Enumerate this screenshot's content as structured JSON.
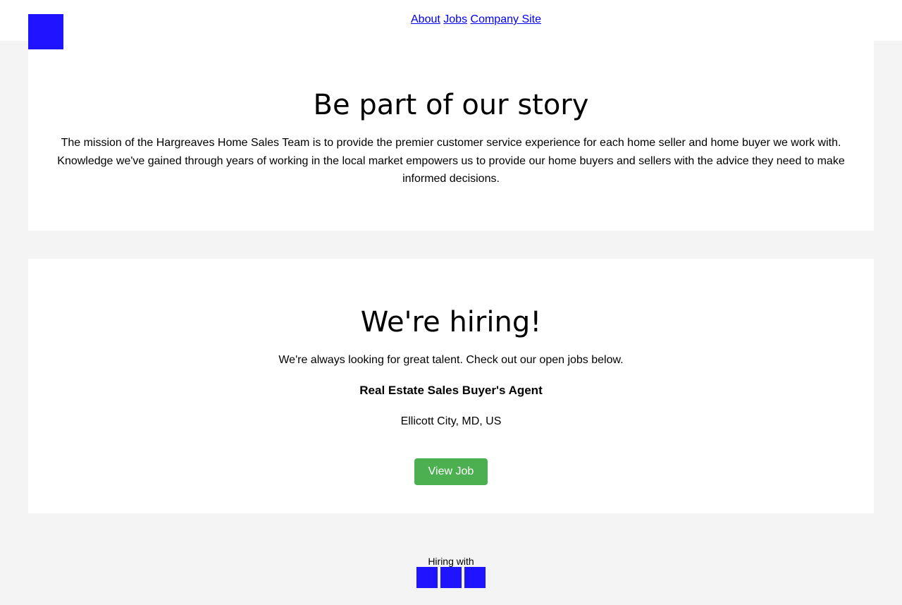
{
  "header": {
    "logo_icon": "company-logo",
    "nav": [
      {
        "label": "About"
      },
      {
        "label": "Jobs"
      },
      {
        "label": "Company Site"
      }
    ]
  },
  "story": {
    "title": "Be part of our story",
    "text": "The mission of the Hargreaves Home Sales Team is to provide the premier customer service experience for each home seller and home buyer we work with. Knowledge we've gained through years of working in the local market empowers us to provide our home buyers and sellers with the advice they need to make informed decisions."
  },
  "hiring": {
    "title": "We're hiring!",
    "tagline": "We're always looking for great talent. Check out our open jobs below.",
    "job": {
      "title": "Real Estate Sales Buyer's Agent",
      "location": "Ellicott City, MD, US",
      "button_label": "View Job"
    }
  },
  "footer": {
    "label": "Hiring with",
    "badges": [
      "partner-logo-1",
      "partner-logo-2",
      "partner-logo-3"
    ]
  },
  "colors": {
    "logo": "#1f14ff",
    "button": "#4caf50",
    "link": "#0000ee",
    "background": "#f4f4f4"
  }
}
